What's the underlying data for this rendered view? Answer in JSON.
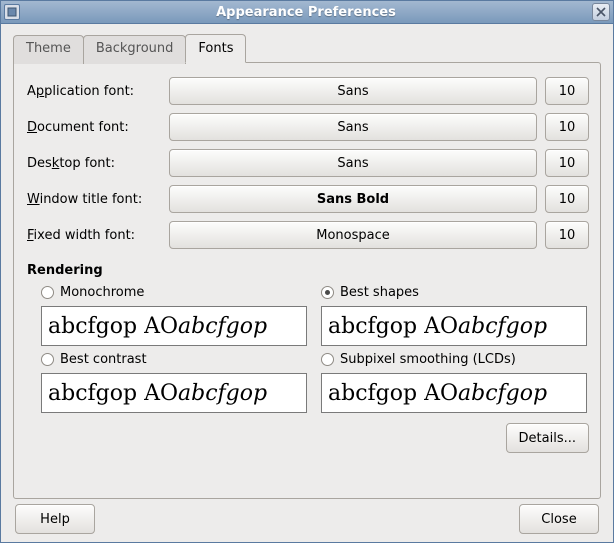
{
  "window": {
    "title": "Appearance Preferences"
  },
  "tabs": {
    "theme": "Theme",
    "background": "Background",
    "fonts": "Fonts"
  },
  "fonts": {
    "application": {
      "label_pre": "A",
      "label_ul": "p",
      "label_post": "plication font:",
      "name": "Sans",
      "size": "10"
    },
    "document": {
      "label_pre": "",
      "label_ul": "D",
      "label_post": "ocument font:",
      "name": "Sans",
      "size": "10"
    },
    "desktop": {
      "label_pre": "Des",
      "label_ul": "k",
      "label_post": "top font:",
      "name": "Sans",
      "size": "10"
    },
    "windowtitle": {
      "label_pre": "",
      "label_ul": "W",
      "label_post": "indow title font:",
      "name": "Sans Bold",
      "size": "10"
    },
    "fixed": {
      "label_pre": "",
      "label_ul": "F",
      "label_post": "ixed width font:",
      "name": "Monospace",
      "size": "10"
    }
  },
  "rendering": {
    "heading": "Rendering",
    "monochrome": {
      "pre": "",
      "ul": "M",
      "post": "onochrome"
    },
    "bestshapes": {
      "pre": "Best ",
      "ul": "s",
      "post": "hapes"
    },
    "bestcontrast": {
      "pre": "Best ",
      "ul": "c",
      "post": "ontrast"
    },
    "subpixel": {
      "pre": "Sub",
      "ul": "p",
      "post": "ixel smoothing (LCDs)"
    },
    "preview_normal": "abcfgop AO ",
    "preview_italic": "abcfgop"
  },
  "buttons": {
    "details": {
      "pre": "",
      "ul": "D",
      "post": "etails..."
    },
    "help": {
      "pre": "",
      "ul": "H",
      "post": "elp"
    },
    "close": {
      "pre": "",
      "ul": "C",
      "post": "lose"
    }
  }
}
